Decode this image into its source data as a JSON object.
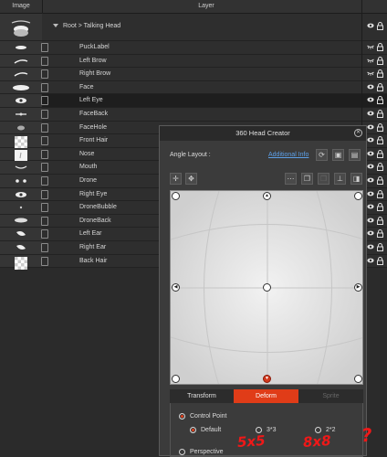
{
  "header": {
    "col_image": "Image",
    "col_layer": "Layer"
  },
  "root": {
    "label": "Root > Talking Head",
    "eye": "eye-icon",
    "lock": "lock-icon"
  },
  "layers": [
    {
      "name": "PuckLabel",
      "thumb": "puck-label-thumb",
      "vis": "closed"
    },
    {
      "name": "Left Brow",
      "thumb": "brow-thumb",
      "vis": "closed"
    },
    {
      "name": "Right Brow",
      "thumb": "brow-thumb",
      "vis": "closed"
    },
    {
      "name": "Face",
      "thumb": "face-thumb",
      "vis": "open"
    },
    {
      "name": "Left Eye",
      "thumb": "eye-thumb",
      "vis": "open",
      "selected": true
    },
    {
      "name": "FaceBack",
      "thumb": "faceback-thumb",
      "vis": "open"
    },
    {
      "name": "FaceHole",
      "thumb": "facehole-thumb",
      "vis": "open"
    },
    {
      "name": "Front Hair",
      "thumb": "checker-thumb",
      "vis": "open"
    },
    {
      "name": "Nose",
      "thumb": "nose-thumb",
      "vis": "open"
    },
    {
      "name": "Mouth",
      "thumb": "mouth-thumb",
      "vis": "open"
    },
    {
      "name": "Drone",
      "thumb": "drone-thumb",
      "vis": "open"
    },
    {
      "name": "Right Eye",
      "thumb": "eye-thumb",
      "vis": "open"
    },
    {
      "name": "DroneBubble",
      "thumb": "dot-thumb",
      "vis": "open"
    },
    {
      "name": "DroneBack",
      "thumb": "droneback-thumb",
      "vis": "open"
    },
    {
      "name": "Left Ear",
      "thumb": "ear-thumb",
      "vis": "open"
    },
    {
      "name": "Right Ear",
      "thumb": "ear-thumb",
      "vis": "open"
    },
    {
      "name": "Back Hair",
      "thumb": "checker-thumb",
      "vis": "open"
    }
  ],
  "dialog": {
    "title": "360 Head Creator",
    "close_icon": "close-icon",
    "angle_layout_label": "Angle Layout :",
    "additional_info": "Additional Info",
    "tabs": [
      {
        "label": "Transform"
      },
      {
        "label": "Deform",
        "active": true
      },
      {
        "label": "Sprite",
        "disabled": true
      }
    ],
    "control_point_label": "Control Point",
    "options": [
      {
        "label": "Default",
        "selected": true
      },
      {
        "label": "3*3"
      },
      {
        "label": "2*2"
      }
    ],
    "perspective_label": "Perspective"
  },
  "annotations": {
    "a1": "5x5",
    "a2": "8x8",
    "a3": "?"
  },
  "colors": {
    "accent": "#e03c18",
    "link": "#5da0e8",
    "annotation": "#f01818"
  }
}
